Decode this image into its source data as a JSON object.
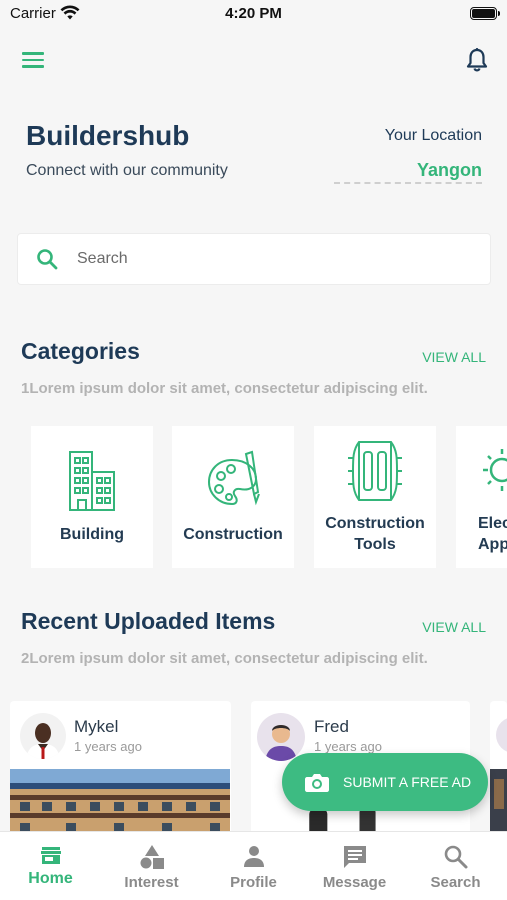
{
  "status_bar": {
    "carrier": "Carrier",
    "time": "4:20 PM"
  },
  "header": {
    "title": "Buildershub",
    "tagline": "Connect with our community",
    "location_label": "Your Location",
    "location_value": "Yangon",
    "menu_icon": "hamburger-icon",
    "notification_icon": "bell-icon"
  },
  "search": {
    "placeholder": "Search",
    "value": ""
  },
  "categories": {
    "title": "Categories",
    "subtitle": "1Lorem ipsum dolor sit amet, consectetur adipiscing elit.",
    "view_all": "VIEW ALL",
    "items": [
      {
        "label": "Building",
        "icon": "building-icon"
      },
      {
        "label": "Construction",
        "icon": "palette-icon"
      },
      {
        "label": "Construction Tools",
        "icon": "tools-icon"
      },
      {
        "label": "Elec Appl",
        "icon": "bulb-icon"
      }
    ]
  },
  "recent": {
    "title": "Recent Uploaded Items",
    "subtitle": "2Lorem ipsum dolor sit amet, consectetur adipiscing elit.",
    "view_all": "VIEW ALL",
    "items": [
      {
        "user": "Mykel",
        "time": "1 years ago"
      },
      {
        "user": "Fred",
        "time": "1 years ago"
      }
    ]
  },
  "fab": {
    "label": "SUBMIT A FREE AD",
    "icon": "camera-icon"
  },
  "tabs": [
    {
      "label": "Home",
      "icon": "store-icon",
      "active": true
    },
    {
      "label": "Interest",
      "icon": "shapes-icon",
      "active": false
    },
    {
      "label": "Profile",
      "icon": "person-icon",
      "active": false
    },
    {
      "label": "Message",
      "icon": "chat-icon",
      "active": false
    },
    {
      "label": "Search",
      "icon": "search-icon",
      "active": false
    }
  ],
  "colors": {
    "accent": "#34b57a",
    "title": "#1e3a57",
    "background": "#f6f6f6"
  }
}
